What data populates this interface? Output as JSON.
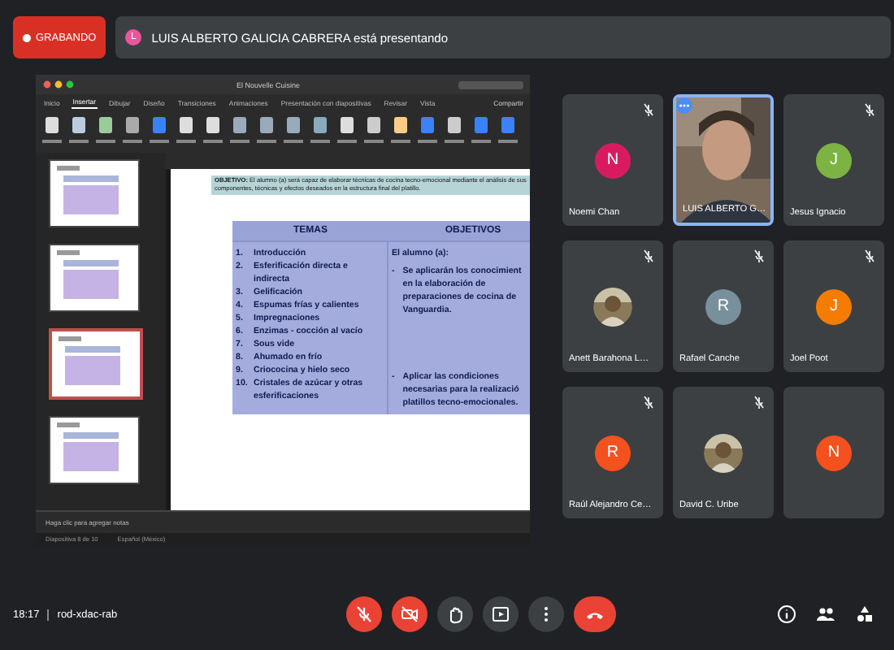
{
  "recording": {
    "label": "GRABANDO"
  },
  "presenter_banner": {
    "initial": "L",
    "text": "LUIS ALBERTO GALICIA CABRERA está presentando"
  },
  "presentation": {
    "title": "El Nouvelle Cuisine",
    "share": "Compartir",
    "tabs": [
      {
        "label": "Inicio",
        "selected": false
      },
      {
        "label": "Insertar",
        "selected": true
      },
      {
        "label": "Dibujar",
        "selected": false
      },
      {
        "label": "Diseño",
        "selected": false
      },
      {
        "label": "Transiciones",
        "selected": false
      },
      {
        "label": "Animaciones",
        "selected": false
      },
      {
        "label": "Presentación con diapositivas",
        "selected": false
      },
      {
        "label": "Revisar",
        "selected": false
      },
      {
        "label": "Vista",
        "selected": false
      }
    ],
    "thumbnails": [
      {
        "selected": false
      },
      {
        "selected": false
      },
      {
        "selected": true
      },
      {
        "selected": false
      }
    ],
    "slide": {
      "objective": "**OBJETIVO:** El alumno (a) será capaz de elaborar técnicas de cocina tecno-emocional mediante el análisis de sus componentes, técnicas y efectos deseados en la estructura final del platillo.",
      "columns": [
        "TEMAS",
        "OBJETIVOS"
      ],
      "topics": [
        {
          "number": "1.",
          "text": "Introducción"
        },
        {
          "number": "2.",
          "text": "Esferificación directa e indirecta"
        },
        {
          "number": "3.",
          "text": "Gelificación"
        },
        {
          "number": "4.",
          "text": "Espumas frías y calientes"
        },
        {
          "number": "5.",
          "text": "Impregnaciones"
        },
        {
          "number": "6.",
          "text": "Enzimas - cocción al vacío"
        },
        {
          "number": "7.",
          "text": "Sous vide"
        },
        {
          "number": "8.",
          "text": "Ahumado en frío"
        },
        {
          "number": "9.",
          "text": "Criococina y hielo seco"
        },
        {
          "number": "10.",
          "text": "Cristales de azúcar y otras esferificaciones"
        }
      ],
      "objectives_intro": "El alumno (a):",
      "objectives": [
        {
          "marker": "-",
          "lines": [
            "Se aplicarán los conocimient",
            "en la elaboración de",
            "preparaciones de cocina de",
            "Vanguardia."
          ]
        },
        {
          "marker": "-",
          "lines": [
            "Aplicar las condiciones",
            "necesarias para la realizació",
            "platillos tecno-emocionales."
          ]
        }
      ]
    },
    "notes_placeholder": "Haga clic para agregar notas",
    "status": [
      "Diapositiva 8 de 10",
      "Español (México)"
    ]
  },
  "participants": [
    {
      "kind": "avatar",
      "name": "Noemi Chan",
      "initial": "N",
      "color": "#d81b60",
      "muted": true
    },
    {
      "kind": "video",
      "name": "LUIS ALBERTO G…",
      "muted": false
    },
    {
      "kind": "avatar",
      "name": "Jesus Ignacio",
      "initial": "J",
      "color": "#7cb342",
      "muted": true
    },
    {
      "name": "Anett Barahona L…",
      "muted": true
    },
    {
      "kind": "avatar",
      "name": "Rafael Canche",
      "initial": "R",
      "color": "#78909c",
      "muted": true
    },
    {
      "kind": "avatar",
      "name": "Joel Poot",
      "initial": "J",
      "color": "#f57c00",
      "muted": true
    },
    {
      "kind": "avatar",
      "name": "Raúl Alejandro Ce…",
      "initial": "R",
      "color": "#f4511e",
      "muted": true
    },
    {
      "name": "David C. Uribe",
      "muted": true
    },
    {
      "kind": "avatar",
      "initial": "N",
      "color": "#f4511e",
      "muted": false
    }
  ],
  "meeting": {
    "time": "18:17",
    "code": "rod-xdac-rab"
  },
  "controls": [
    {
      "kind": "mic",
      "on": false
    },
    {
      "kind": "camera",
      "on": false
    },
    {
      "kind": "hand"
    },
    {
      "kind": "present"
    },
    {
      "kind": "more"
    },
    {
      "kind": "end"
    }
  ],
  "side_controls": [
    {
      "kind": "info"
    },
    {
      "kind": "people"
    },
    {
      "kind": "activities"
    }
  ]
}
